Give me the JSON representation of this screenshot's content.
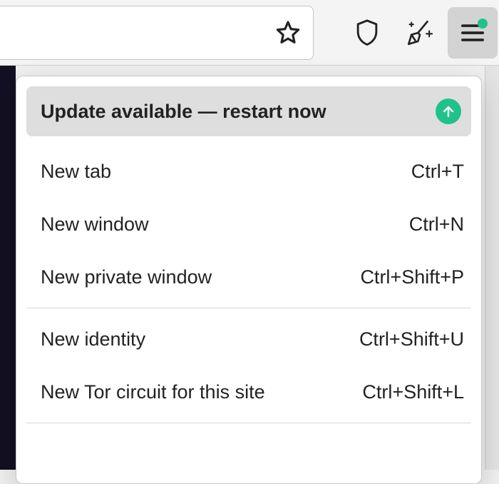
{
  "toolbar": {
    "star_icon": "star",
    "shield_icon": "shield",
    "broom_icon": "broom",
    "menu_icon": "hamburger"
  },
  "menu": {
    "update": {
      "label": "Update available — restart now"
    },
    "groups": [
      [
        {
          "label": "New tab",
          "shortcut": "Ctrl+T"
        },
        {
          "label": "New window",
          "shortcut": "Ctrl+N"
        },
        {
          "label": "New private window",
          "shortcut": "Ctrl+Shift+P"
        }
      ],
      [
        {
          "label": "New identity",
          "shortcut": "Ctrl+Shift+U"
        },
        {
          "label": "New Tor circuit for this site",
          "shortcut": "Ctrl+Shift+L"
        }
      ]
    ]
  }
}
